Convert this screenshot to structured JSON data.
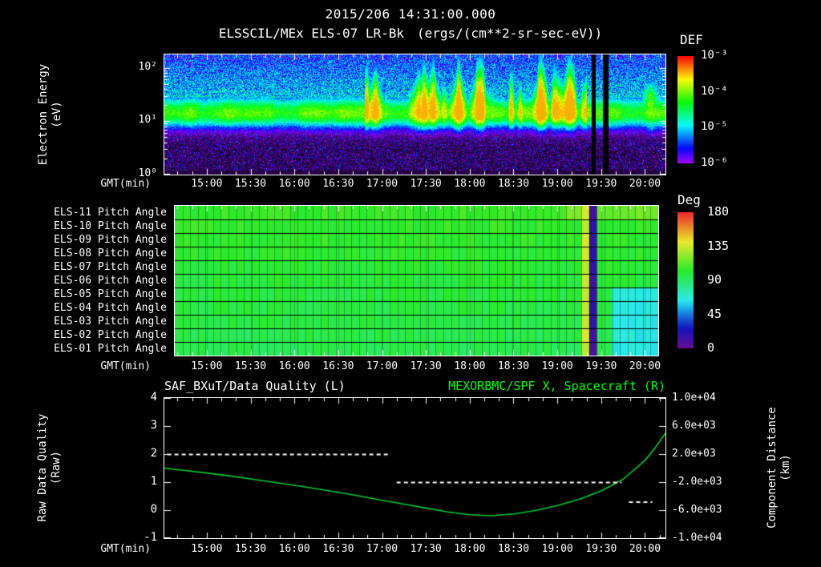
{
  "header": {
    "title": "2015/206 14:31:00.000"
  },
  "colors": {
    "background": "#000000",
    "text": "#ffffff",
    "green": "#00ff00",
    "spacecraft_line": "#00cc33",
    "quality_line": "#ffffff"
  },
  "time_axis": {
    "start": "14:31",
    "end": "20:14",
    "xlabel": "GMT(min)",
    "tick_labels": [
      "15:00",
      "15:30",
      "16:00",
      "16:30",
      "17:00",
      "17:30",
      "18:00",
      "18:30",
      "19:00",
      "19:30",
      "20:00"
    ]
  },
  "spectrogram": {
    "title": "ELSSCIL/MEx ELS-07 LR-Bk",
    "units": "(ergs/(cm**2-sr-sec-eV))",
    "colorbar_title": "DEF",
    "colorbar_ticks": [
      "10⁻³",
      "10⁻⁴",
      "10⁻⁵",
      "10⁻⁶"
    ],
    "ylabel": "Electron Energy",
    "ylabel_units": "(eV)",
    "xlabel": "GMT(min)",
    "y_ticks": [
      "10²",
      "10¹",
      "10⁰"
    ]
  },
  "pitch": {
    "row_labels": [
      "ELS-11 Pitch Angle",
      "ELS-10 Pitch Angle",
      "ELS-09 Pitch Angle",
      "ELS-08 Pitch Angle",
      "ELS-07 Pitch Angle",
      "ELS-06 Pitch Angle",
      "ELS-05 Pitch Angle",
      "ELS-04 Pitch Angle",
      "ELS-03 Pitch Angle",
      "ELS-02 Pitch Angle",
      "ELS-01 Pitch Angle"
    ],
    "colorbar_title": "Deg",
    "colorbar_ticks": [
      "180",
      "135",
      "90",
      "45",
      "0"
    ],
    "xlabel": "GMT(min)"
  },
  "bottom": {
    "left_title": "SAF_BXuT/Data Quality (L)",
    "right_title": "MEXORBMC/SPF X, Spacecraft (R)",
    "left_ylabel": "Raw Data Quality",
    "left_ylabel_units": "(Raw)",
    "right_ylabel": "Component Distance",
    "right_ylabel_units": "(km)",
    "xlabel": "GMT(min)",
    "left_ticks": [
      "4",
      "3",
      "2",
      "1",
      "0",
      "-1"
    ],
    "right_ticks": [
      "1.0e+04",
      "6.0e+03",
      "2.0e+03",
      "-2.0e+03",
      "-6.0e+03",
      "-1.0e+04"
    ]
  },
  "chart_data": [
    {
      "type": "heatmap",
      "title": "ELSSCIL/MEx ELS-07 LR-Bk",
      "units": "ergs/(cm**2-sr-sec-eV)",
      "x": {
        "label": "GMT(min)",
        "start": "14:31",
        "end": "20:14",
        "tick_labels": [
          "15:00",
          "15:30",
          "16:00",
          "16:30",
          "17:00",
          "17:30",
          "18:00",
          "18:30",
          "19:00",
          "19:30",
          "20:00"
        ]
      },
      "y": {
        "label": "Electron Energy (eV)",
        "scale": "log",
        "min": 1,
        "max": 178,
        "tick_values": [
          1,
          10,
          100
        ]
      },
      "color": {
        "label": "DEF",
        "scale": "log",
        "min": 1e-06,
        "max": 0.001,
        "colormap": "rainbow"
      },
      "features": [
        {
          "type": "band",
          "description": "continuous intense electron band ~5-35 eV across whole interval",
          "energy_log10_center": 1.15,
          "sigma_down": 0.22,
          "sigma_up": 0.28,
          "peak_log10_flux": -4.15
        },
        {
          "type": "bursts",
          "description": "intermittent bursty enhancements extending to ~100+ eV",
          "time": [
            "16:48",
            "19:20"
          ]
        },
        {
          "type": "spike",
          "time": "16:55"
        },
        {
          "type": "spike",
          "time": "17:25"
        },
        {
          "type": "spike",
          "time": "17:35"
        },
        {
          "type": "spike",
          "time": "17:52"
        },
        {
          "type": "spike",
          "time": "18:05"
        },
        {
          "type": "spike",
          "time": "18:48"
        },
        {
          "type": "spike",
          "time": "19:08"
        },
        {
          "type": "gap",
          "description": "black data-gap stripe",
          "time": [
            "19:23",
            "19:26"
          ]
        },
        {
          "type": "gap",
          "description": "black data-gap stripe",
          "time": [
            "19:31",
            "19:35"
          ]
        },
        {
          "type": "blob",
          "description": "broad bright green patch near end of interval",
          "time": [
            "19:55",
            "20:12"
          ],
          "energy_log10_center": 1.3,
          "peak_log10_flux": -4.05
        }
      ]
    },
    {
      "type": "heatmap",
      "title": "ELS Pitch Angle panels",
      "rows": [
        "ELS-11",
        "ELS-10",
        "ELS-09",
        "ELS-08",
        "ELS-07",
        "ELS-06",
        "ELS-05",
        "ELS-04",
        "ELS-03",
        "ELS-02",
        "ELS-01"
      ],
      "color": {
        "label": "Deg",
        "min": 0,
        "max": 180,
        "colormap": "rainbow"
      },
      "typical_value_deg": 100,
      "features": [
        {
          "type": "stripe",
          "description": "yellow stripe all rows",
          "time": [
            "19:17",
            "19:20"
          ],
          "value_deg": 134
        },
        {
          "type": "stripe",
          "description": "dark blue stripe all rows",
          "time": [
            "19:22",
            "19:27"
          ],
          "value_deg": 15
        },
        {
          "type": "stripe",
          "description": "dark blue stripe all rows",
          "time": [
            "19:30",
            "19:34"
          ],
          "value_deg": 15
        },
        {
          "type": "gap",
          "time": [
            "19:28",
            "19:29"
          ]
        },
        {
          "type": "region",
          "description": "ELS-01..ELS-05 drop to ~65 deg near end",
          "time": [
            "19:36",
            "20:14"
          ],
          "sensors": [
            1,
            2,
            3,
            4,
            5
          ],
          "value_deg": 66
        },
        {
          "type": "region",
          "description": "ELS-11 rises to ~115-120 deg near end",
          "time": [
            "19:05",
            "20:14"
          ],
          "sensors": [
            11
          ],
          "value_deg": 117
        }
      ]
    },
    {
      "type": "line",
      "x": {
        "label": "GMT(min)",
        "start": "14:31",
        "end": "20:14"
      },
      "left_axis": {
        "label": "Raw Data Quality (Raw)",
        "min": -1,
        "max": 4,
        "tick_values": [
          4,
          3,
          2,
          1,
          0,
          -1
        ]
      },
      "right_axis": {
        "label": "Component Distance (km)",
        "min": -10000,
        "max": 10000,
        "tick_values": [
          10000,
          6000,
          2000,
          -2000,
          -6000,
          -10000
        ]
      },
      "series": [
        {
          "name": "MEXORBMC/SPF X, Spacecraft (R)",
          "axis": "right",
          "units": "km",
          "color": "#00cc33",
          "style": "solid",
          "points": [
            [
              "14:31",
              0
            ],
            [
              "14:45",
              -350
            ],
            [
              "15:00",
              -700
            ],
            [
              "15:15",
              -1100
            ],
            [
              "15:30",
              -1550
            ],
            [
              "15:45",
              -2000
            ],
            [
              "16:00",
              -2450
            ],
            [
              "16:15",
              -2950
            ],
            [
              "16:30",
              -3450
            ],
            [
              "16:45",
              -4000
            ],
            [
              "17:00",
              -4600
            ],
            [
              "17:15",
              -5150
            ],
            [
              "17:30",
              -5700
            ],
            [
              "17:45",
              -6250
            ],
            [
              "18:00",
              -6650
            ],
            [
              "18:15",
              -6800
            ],
            [
              "18:30",
              -6550
            ],
            [
              "18:45",
              -6050
            ],
            [
              "19:00",
              -5350
            ],
            [
              "19:15",
              -4450
            ],
            [
              "19:30",
              -3250
            ],
            [
              "19:45",
              -1600
            ],
            [
              "20:00",
              1100
            ],
            [
              "20:07",
              2900
            ],
            [
              "20:14",
              5000
            ]
          ]
        },
        {
          "name": "SAF_BXuT/Data Quality (L)",
          "axis": "left",
          "color": "#ffffff",
          "style": "dashed",
          "segments": [
            {
              "start": "14:33",
              "end": "17:04",
              "value": 2
            },
            {
              "start": "17:10",
              "end": "19:44",
              "value": 1
            },
            {
              "start": "19:49",
              "end": "20:05",
              "value": 0.3
            }
          ]
        }
      ]
    }
  ]
}
